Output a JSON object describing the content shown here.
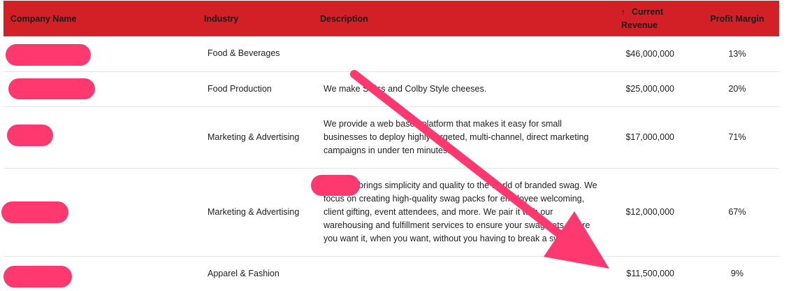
{
  "table": {
    "headers": {
      "company": "Company Name",
      "industry": "Industry",
      "description": "Description",
      "revenue_sort_icon": "arrow-up-icon",
      "revenue_line1": "Current",
      "revenue_line2": "Revenue",
      "profit_margin": "Profit Margin"
    },
    "rows": [
      {
        "company": "",
        "industry": "Food & Beverages",
        "description": "",
        "revenue": "$46,000,000",
        "margin": "13%"
      },
      {
        "company": "",
        "industry": "Food Production",
        "description": "We make Swiss and Colby Style cheeses.",
        "revenue": "$25,000,000",
        "margin": "20%"
      },
      {
        "company": "",
        "industry": "Marketing & Advertising",
        "description": "We provide a web based platform that makes it easy for small businesses to deploy highly targeted, multi-channel, direct marketing campaigns in under ten minutes.",
        "revenue": "$17,000,000",
        "margin": "71%"
      },
      {
        "company": "",
        "industry": "Marketing & Advertising",
        "description": "brings simplicity and quality to the world of branded swag. We focus on creating high-quality swag packs for employee welcoming, client gifting, event attendees, and more. We pair it with our warehousing and fulfillment services to ensure your swag gets where you want it, when you want, without you having to break a sweat.",
        "revenue": "$12,000,000",
        "margin": "67%"
      },
      {
        "company": "",
        "industry": "Apparel & Fashion",
        "description": "",
        "revenue": "$11,500,000",
        "margin": "9%"
      }
    ]
  },
  "colors": {
    "header_bg": "#d32027",
    "annotation": "#ff3870"
  },
  "annotation": {
    "type": "arrow",
    "points_to": "Current Revenue column"
  }
}
